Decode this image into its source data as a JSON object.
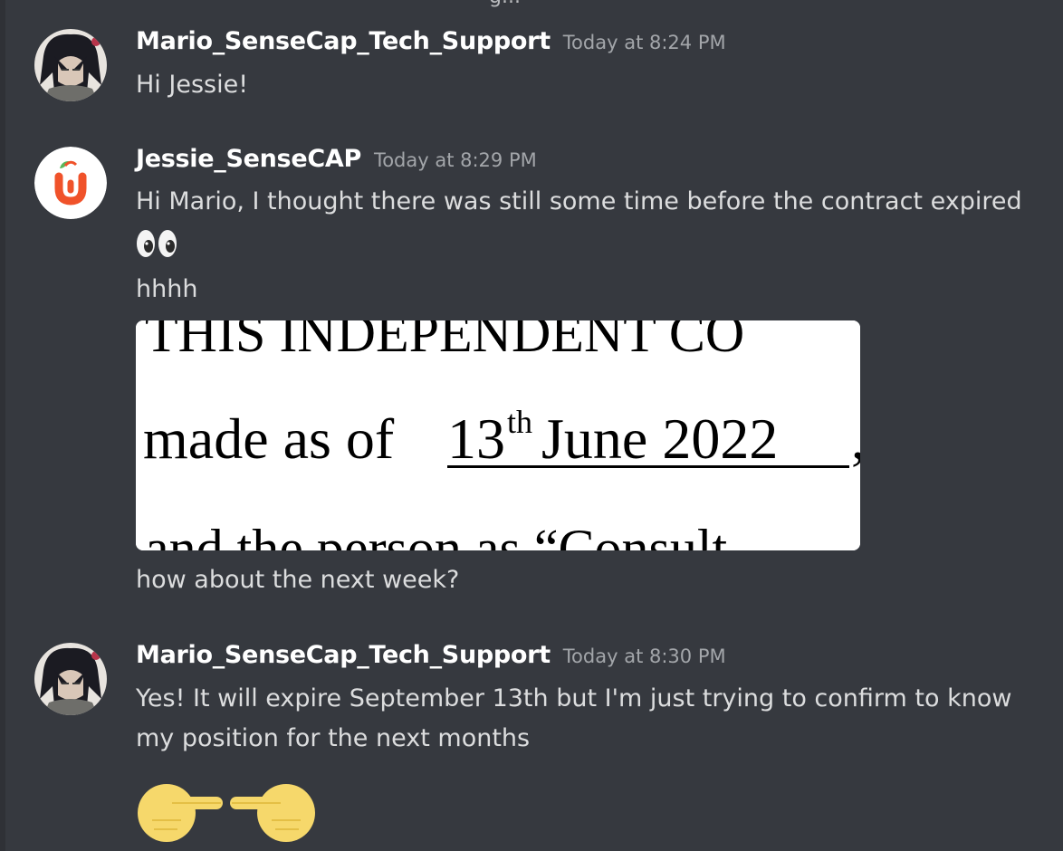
{
  "top_fragment": "g...",
  "messages": [
    {
      "author": "Mario_SenseCap_Tech_Support",
      "time": "Today at 8:24 PM",
      "lines": [
        "Hi Jessie!"
      ]
    },
    {
      "author": "Jessie_SenseCAP",
      "time": "Today at 8:29 PM",
      "lines": [
        "Hi Mario, I thought there was still some time before the contract expired",
        "hhhh",
        "how about the next week?"
      ],
      "emoji": "eyes-emoji",
      "attachment": {
        "line1": "THIS INDEPENDENT CO",
        "line2_prefix": "made as of ",
        "line2_day": "13",
        "line2_sup": "th",
        "line2_rest": " June 2022",
        "line2_tail": ",",
        "line3": "and the person as “Consult"
      }
    },
    {
      "author": "Mario_SenseCap_Tech_Support",
      "time": "Today at 8:30 PM",
      "lines": [
        "Yes! It will expire September 13th but I'm just trying to confirm to know",
        "my position for the next months"
      ],
      "emoji": "pointing-fingers-emoji"
    }
  ],
  "colors": {
    "background": "#36393f",
    "username": "#ffffff",
    "timestamp": "#a3a6aa",
    "text": "#dcddde",
    "jessie_avatar_accent": "#f0522a",
    "emoji_yellow": "#f6d86b"
  }
}
